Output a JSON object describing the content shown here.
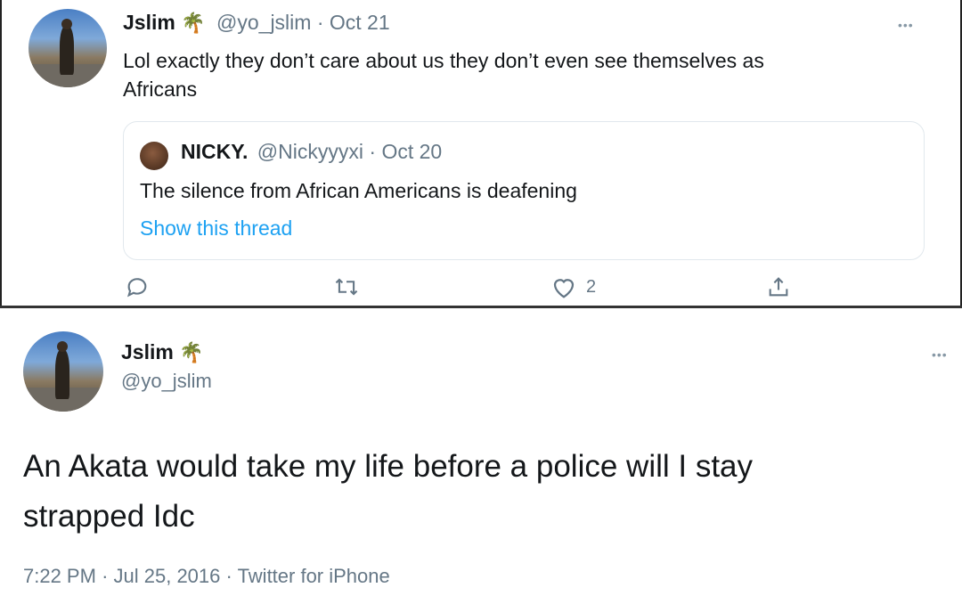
{
  "tweet1": {
    "name": "Jslim",
    "emoji": "🌴",
    "handle": "@yo_jslim",
    "separator": "·",
    "date": "Oct 21",
    "text_line1": "Lol exactly they don’t care about us they don’t even see themselves as",
    "text_line2": "Africans",
    "more": "•••",
    "quote": {
      "name": "NICKY.",
      "handle": "@Nickyyyxi",
      "separator": "·",
      "date": "Oct 20",
      "text": "The silence from African Americans is deafening",
      "link": "Show this thread"
    },
    "actions": {
      "reply_icon": "reply-icon",
      "retweet_icon": "retweet-icon",
      "like_icon": "heart-icon",
      "like_count": "2",
      "share_icon": "share-icon"
    }
  },
  "tweet2": {
    "name": "Jslim",
    "emoji": "🌴",
    "handle": "@yo_jslim",
    "more": "•••",
    "text_line1": "An Akata would take my life before a police will I stay",
    "text_line2": "strapped Idc",
    "time": "7:22 PM",
    "separator1": "·",
    "date": "Jul 25, 2016",
    "separator2": "·",
    "source": "Twitter for iPhone"
  },
  "colors": {
    "link": "#1da1f2",
    "secondary": "#657786",
    "text": "#14171a",
    "border": "#e1e8ed"
  }
}
